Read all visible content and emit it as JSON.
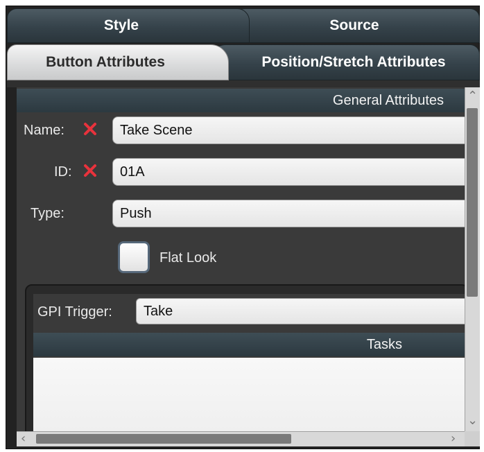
{
  "tabs_top": [
    {
      "label": "Style",
      "active": false
    },
    {
      "label": "Source",
      "active": false
    }
  ],
  "tabs_bottom": [
    {
      "label": "Button Attributes",
      "active": true
    },
    {
      "label": "Position/Stretch Attributes",
      "active": false
    }
  ],
  "general": {
    "header": "General Attributes",
    "name_label": "Name:",
    "name_value": "Take Scene",
    "id_label": "ID:",
    "id_value": "01A",
    "type_label": "Type:",
    "type_value": "Push",
    "flat_look_label": "Flat Look",
    "flat_look_checked": false
  },
  "gpi": {
    "label": "GPI Trigger:",
    "value": "Take"
  },
  "tasks": {
    "header": "Tasks",
    "items": []
  },
  "colors": {
    "required_marker": "#e8323c",
    "header_bar": "#34424a",
    "panel_bg": "#3a3a3a"
  }
}
